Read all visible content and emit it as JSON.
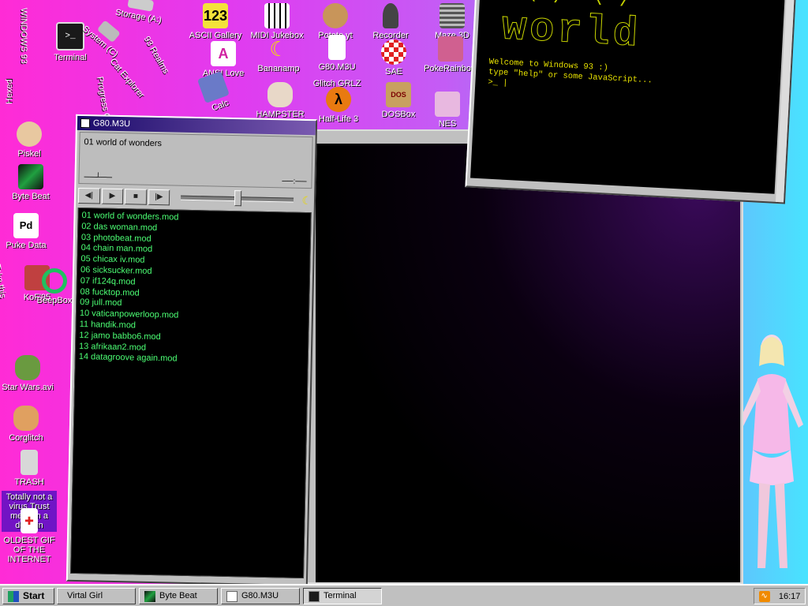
{
  "desktop": {
    "icons": {
      "terminal": "Terminal",
      "system": "System (C)",
      "storage": "Storage (A:)",
      "ascii_gallery": "ASCII Gallery",
      "midi_jukebox": "MIDI Jukebox",
      "potato": "Potato.yt",
      "recorder": "Recorder",
      "maze3d": "Maze 3D",
      "g80": "G80.M3U",
      "bananamp": "Bananamp",
      "ansi_love": "ANSI Love",
      "sae": "SAE",
      "pokerainbow": "PokeRainbow",
      "glitch_grlz": "Glitch GRLZ",
      "calc": "Calc",
      "hampster": "HAMPSTER",
      "half_life": "Half-Life 3",
      "dosbox": "DOSBox",
      "nes": "NES",
      "piskel": "Piskel",
      "byte_beat": "Byte Beat",
      "puke_data": "Puke Data",
      "kof": "KoF'95",
      "beepbox": "BeepBox",
      "star_wars": "Star Wars.avi",
      "corglitch": "Corglitch",
      "trash": "TRASH",
      "virus": "Totally not a virus.Trust me...I'm a dolphin",
      "oldest_gif": "OLDEST GIF OF THE INTERNET"
    },
    "vertical_labels": {
      "windows93": "WINDOWS 93",
      "hexed": "Hexed",
      "cat_explorer": "Cat Explorer",
      "93_realms": "93 Realms",
      "progress_quest": "Progress Quest",
      "take_this": "Take this"
    }
  },
  "player": {
    "title": "G80.M3U",
    "now_playing": "01 world of wonders",
    "pos_left": "──┴──",
    "pos_right": "──:──",
    "controls": {
      "prev": "prev-icon",
      "play": "play-icon",
      "stop": "stop-icon",
      "next": "next-icon"
    },
    "playlist": [
      "01 world of wonders.mod",
      "02 das woman.mod",
      "03 photobeat.mod",
      "04 chain man.mod",
      "05 chicax iv.mod",
      "06 sicksucker.mod",
      "07 if124q.mod",
      "08 fucktop.mod",
      "09 jull.mod",
      "10 vaticanpowerloop.mod",
      "11 handik.mod",
      "12 jamo babbo6.mod",
      "13 afrikaan2.mod",
      "14 datagroove again.mod"
    ]
  },
  "terminal": {
    "line1": "Welcome to Windows 93 :)",
    "line2": "type \"help\" or some JavaScript...",
    "prompt": ">_ |",
    "ascii_art": "world"
  },
  "taskbar": {
    "start": "Start",
    "items": [
      "Virtal Girl",
      "Byte Beat",
      "G80.M3U",
      "Terminal"
    ],
    "clock": "16:17"
  },
  "colors": {
    "playlist_text": "#4cff74",
    "terminal_text": "#e6e000",
    "desktop_gradient_start": "#ff2bd6",
    "desktop_gradient_end": "#48e3ff"
  }
}
